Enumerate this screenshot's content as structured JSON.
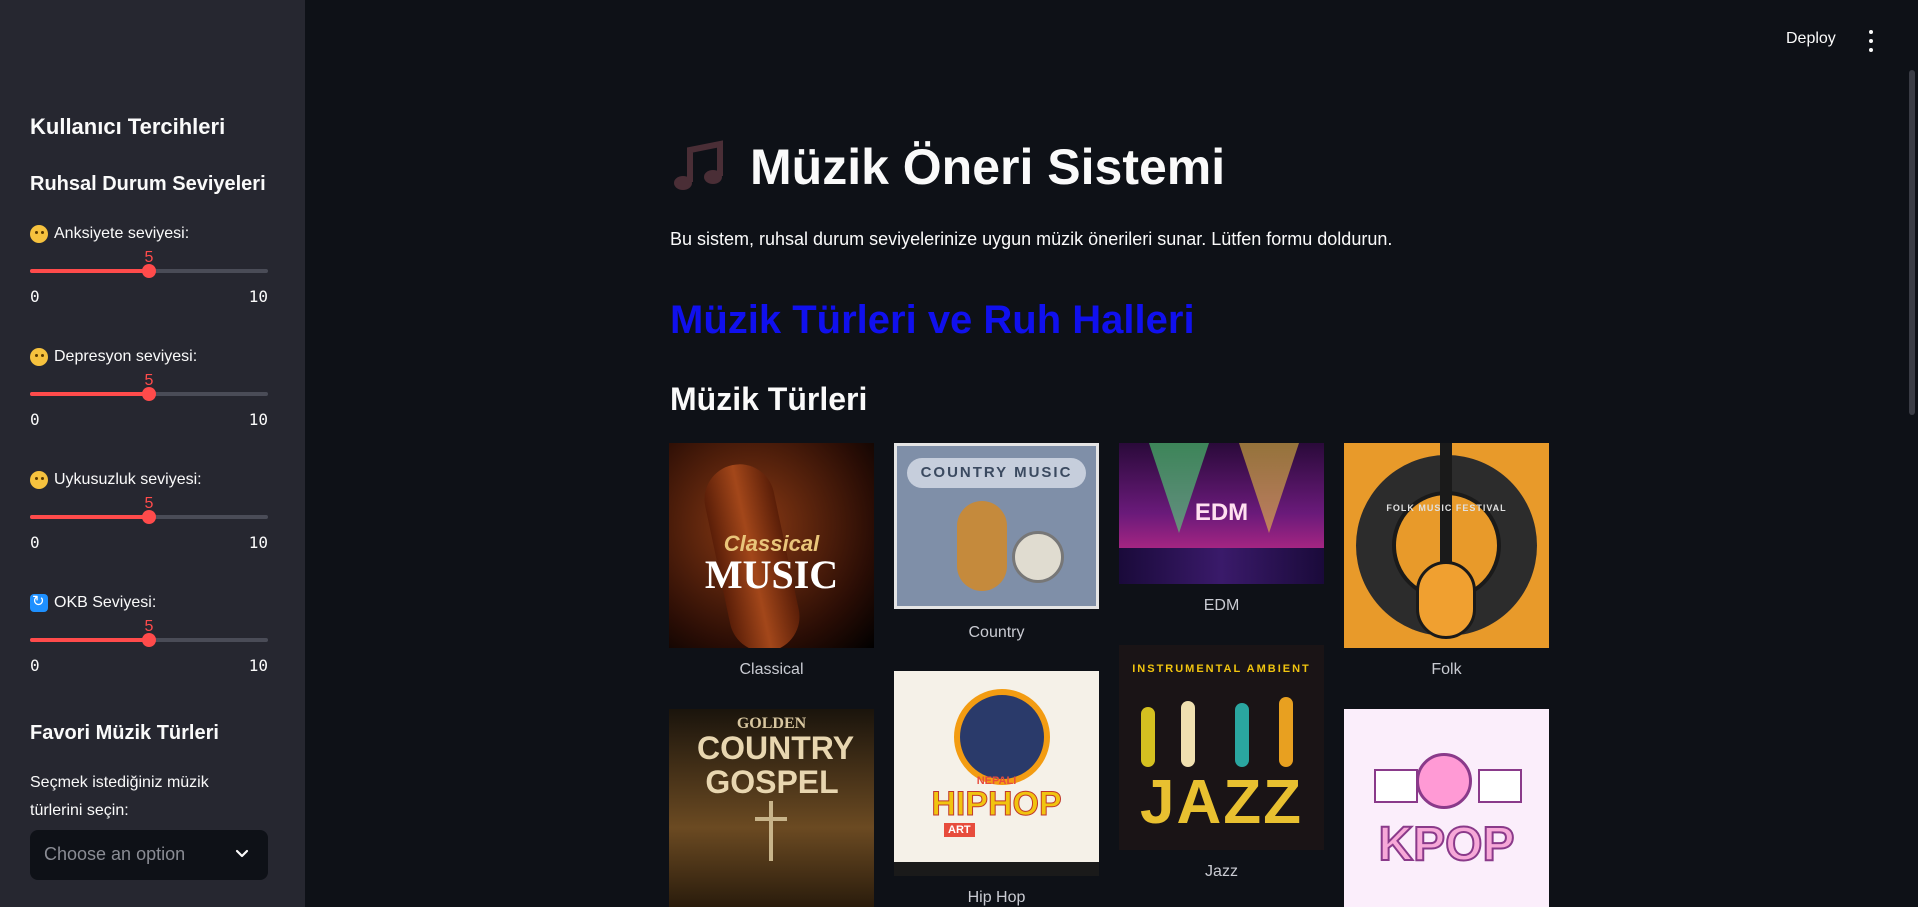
{
  "sidebar": {
    "title": "Kullanıcı Tercihleri",
    "mental_heading": "Ruhsal Durum Seviyeleri",
    "sliders": [
      {
        "label": "Anksiyete seviyesi:",
        "value": "5",
        "min": "0",
        "max": "10",
        "level": 0.5,
        "icon": "flushed-face-emoji"
      },
      {
        "label": "Depresyon seviyesi:",
        "value": "5",
        "min": "0",
        "max": "10",
        "level": 0.5,
        "icon": "pensive-face-emoji"
      },
      {
        "label": "Uykusuzluk seviyesi:",
        "value": "5",
        "min": "0",
        "max": "10",
        "level": 0.5,
        "icon": "sleeping-face-emoji"
      },
      {
        "label": "OKB Seviyesi:",
        "value": "5",
        "min": "0",
        "max": "10",
        "level": 0.5,
        "icon": "repeat-arrows-emoji"
      }
    ],
    "favorites_heading": "Favori Müzik Türleri",
    "favorites_hint": "Seçmek istediğiniz müzik türlerini seçin:",
    "select_placeholder": "Choose an option"
  },
  "header": {
    "deploy_label": "Deploy",
    "menu_icon": "kebab-menu-icon"
  },
  "main": {
    "title": "Müzik Öneri Sistemi",
    "title_icon": "music-note-icon",
    "intro": "Bu sistem, ruhsal durum seviyelerinize uygun müzik önerileri sunar. Lütfen formu doldurun.",
    "section_heading": "Müzik Türleri ve Ruh Halleri",
    "genres_heading": "Müzik Türleri",
    "genres": [
      {
        "caption": "Classical",
        "art_text": "MUSIC",
        "art_script": "Classical"
      },
      {
        "caption": "Country",
        "art_text": "COUNTRY MUSIC"
      },
      {
        "caption": "EDM",
        "art_text": "EDM"
      },
      {
        "caption": "Folk",
        "art_text": "FOLK MUSIC FESTIVAL"
      },
      {
        "caption": "",
        "art_text": "COUNTRY GOSPEL",
        "art_top": "GOLDEN"
      },
      {
        "caption": "Hip Hop",
        "art_text": "HIPHOP",
        "art_small": "NEPALI",
        "art_tag": "ART"
      },
      {
        "caption": "Jazz",
        "art_text": "JAZZ",
        "art_top": "INSTRUMENTAL AMBIENT"
      },
      {
        "caption": "",
        "art_text": "KPOP"
      }
    ]
  },
  "colors": {
    "background": "#0e1117",
    "sidebar": "#262730",
    "accent": "#ff4b4b",
    "heading_blue": "#1010ee"
  }
}
